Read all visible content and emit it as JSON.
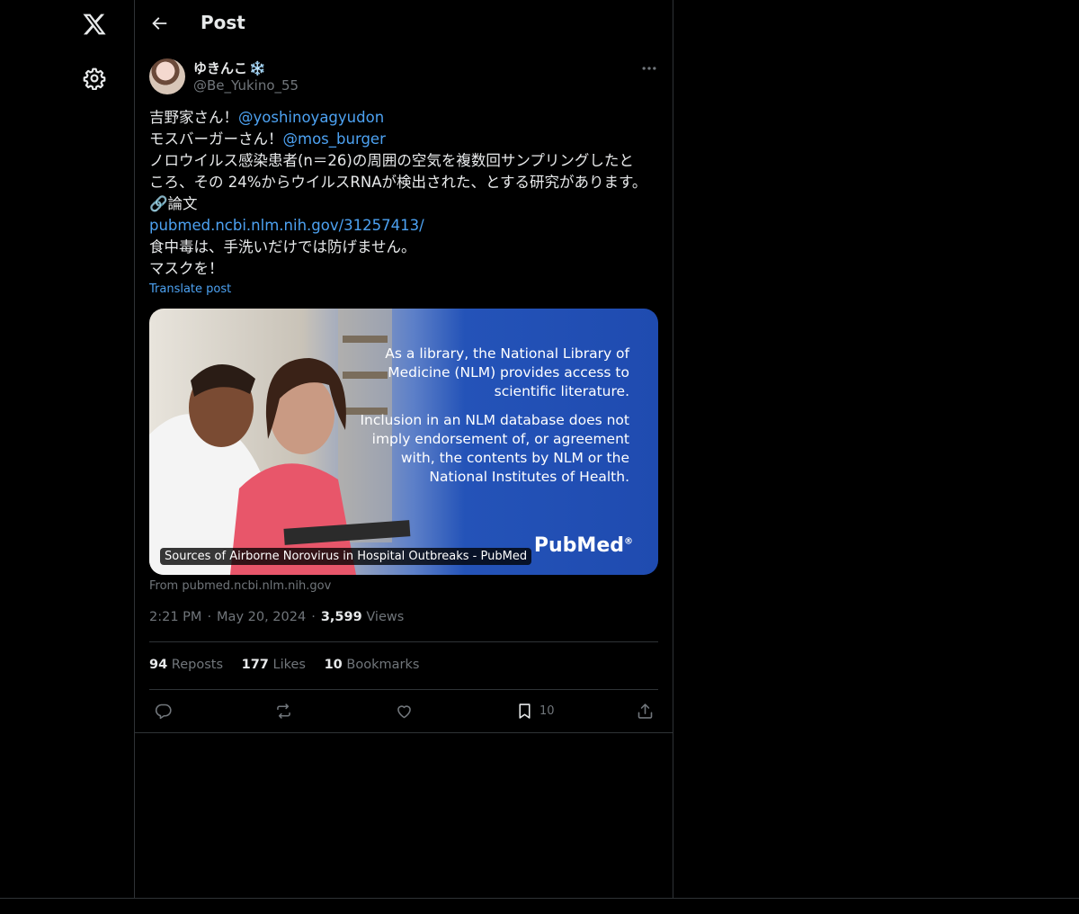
{
  "nav": {
    "logo_icon": "x-logo-icon",
    "settings_icon": "gear-icon"
  },
  "header": {
    "back_icon": "arrow-left-icon",
    "title": "Post"
  },
  "author": {
    "display_name": "ゆきんこ",
    "name_emoji": "❄️",
    "handle": "@Be_Yukino_55"
  },
  "post": {
    "lines": [
      {
        "text": "吉野家さん！",
        "mention": "@yoshinoyagyudon"
      },
      {
        "text": "モスバーガーさん！",
        "mention": "@mos_burger"
      },
      {
        "text": "ノロウイルス感染患者(n＝26)の周囲の空気を複数回サンプリングしたと"
      },
      {
        "text": "ころ、その 24%からウイルスRNAが検出された、とする研究があります。"
      },
      {
        "text": "🔗論文"
      },
      {
        "link": "pubmed.ncbi.nlm.nih.gov/31257413/"
      },
      {
        "text": "食中毒は、手洗いだけでは防げません。"
      },
      {
        "text": "マスクを！"
      }
    ],
    "translate_label": "Translate post"
  },
  "card": {
    "paragraph1": "As a library, the National Library of Medicine (NLM) provides access to scientific literature.",
    "paragraph2": "Inclusion in an NLM database does not imply endorsement of, or agreement with, the contents by NLM or the National Institutes of Health.",
    "logo_text": "PubMed",
    "logo_reg": "®",
    "caption": "Sources of Airborne Norovirus in Hospital Outbreaks - PubMed",
    "from": "From pubmed.ncbi.nlm.nih.gov"
  },
  "meta": {
    "time": "2:21 PM",
    "separator": "·",
    "date": "May 20, 2024",
    "views_count": "3,599",
    "views_label": "Views"
  },
  "stats": {
    "reposts_count": "94",
    "reposts_label": "Reposts",
    "likes_count": "177",
    "likes_label": "Likes",
    "bookmarks_count": "10",
    "bookmarks_label": "Bookmarks"
  },
  "actions": {
    "bookmark_count": "10"
  },
  "colors": {
    "background": "#000000",
    "text": "#e7e9ea",
    "muted": "#71767b",
    "accent": "#4da2f2",
    "border": "#2f3336"
  }
}
